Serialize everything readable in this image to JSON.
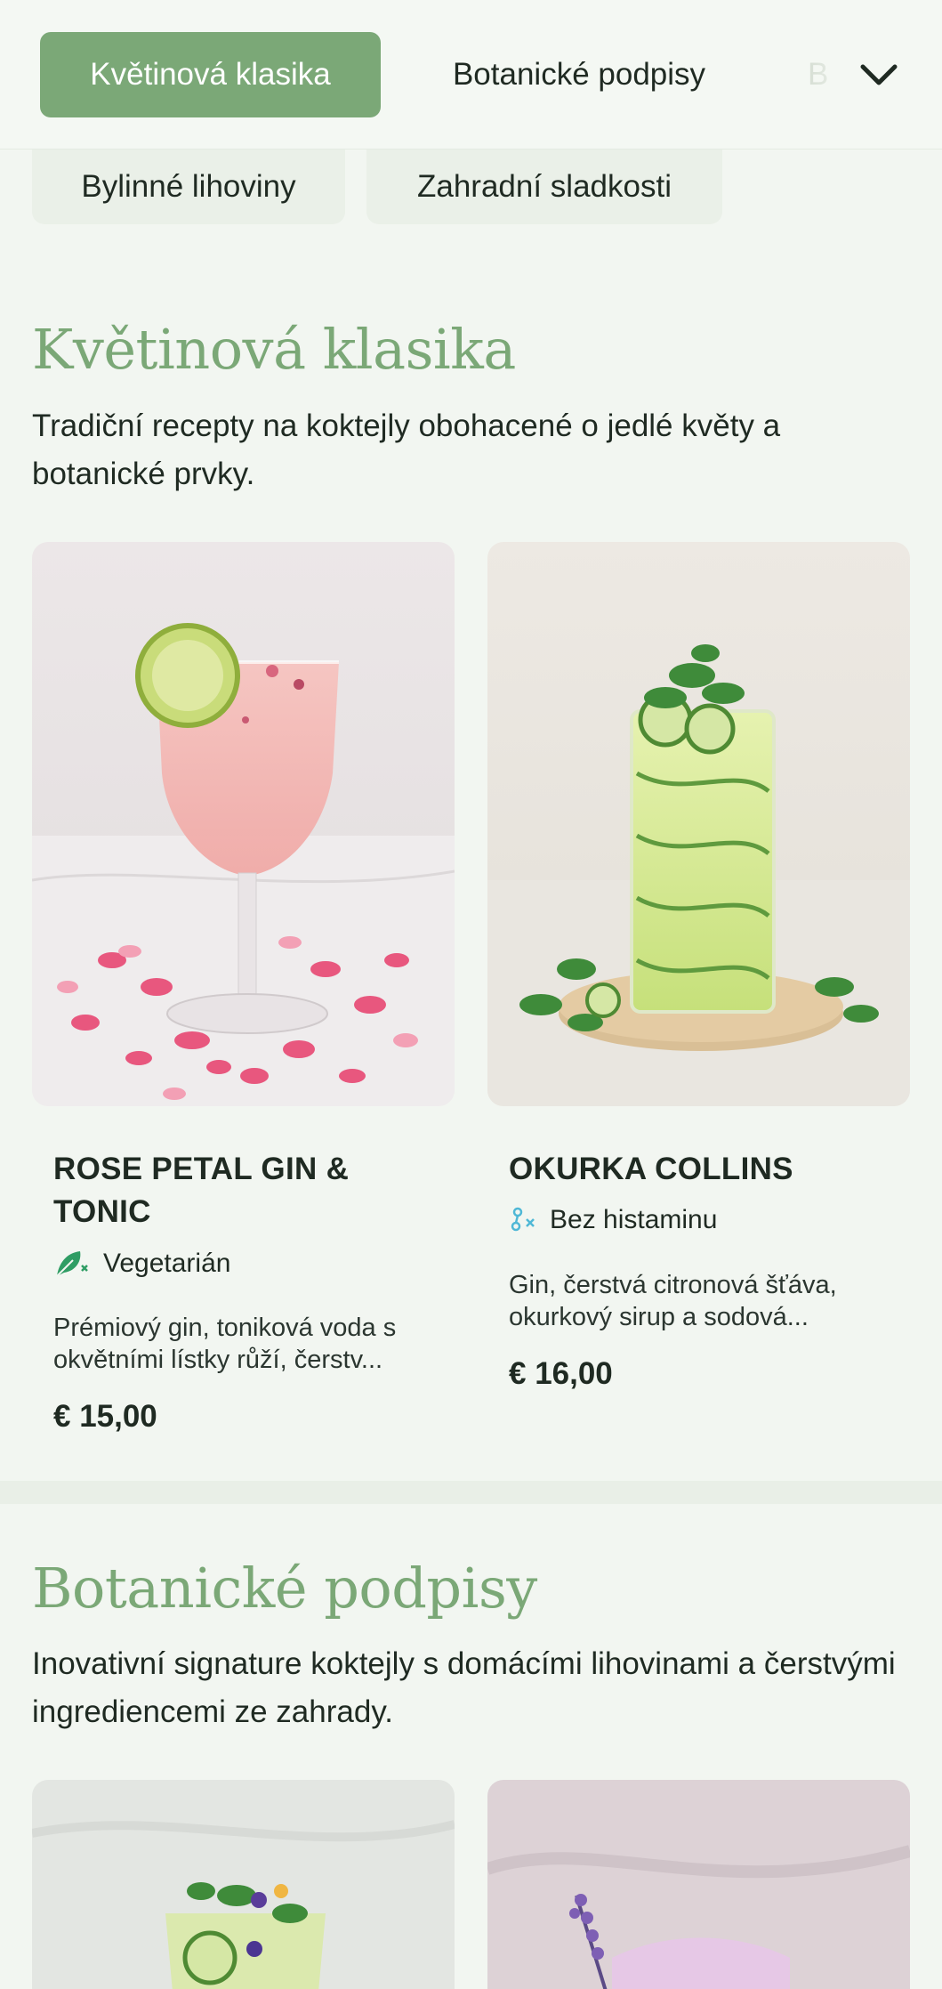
{
  "tabs": [
    {
      "label": "Květinová klasika",
      "active": true
    },
    {
      "label": "Botanické podpisy",
      "active": false
    },
    {
      "label": "B",
      "active": false
    }
  ],
  "chips": [
    "Bylinné lihoviny",
    "Zahradní sladkosti"
  ],
  "sections": [
    {
      "title": "Květinová klasika",
      "description": "Tradiční recepty na koktejly obohacené o jedlé květy a botanické prvky.",
      "items": [
        {
          "name": "ROSE PETAL GIN & TONIC",
          "diet": "Vegetarián",
          "diet_icon": "vegetarian-leaf-icon",
          "description": "Prémiový gin, toniková voda s okvětními lístky růží, čerstv...",
          "price": "€ 15,00"
        },
        {
          "name": "OKURKA COLLINS",
          "diet": "Bez histaminu",
          "diet_icon": "histamine-free-icon",
          "description": "Gin, čerstvá citronová šťáva, okurkový sirup a sodová...",
          "price": "€ 16,00"
        }
      ]
    },
    {
      "title": "Botanické podpisy",
      "description": "Inovativní signature koktejly s domácími lihovinami a čerstvými ingrediencemi ze zahrady."
    }
  ],
  "colors": {
    "accent": "#7ba877",
    "background": "#f2f6f1",
    "text": "#1f2a22",
    "vegetarian": "#2f9d64",
    "histamine_free": "#4fb8d6"
  }
}
